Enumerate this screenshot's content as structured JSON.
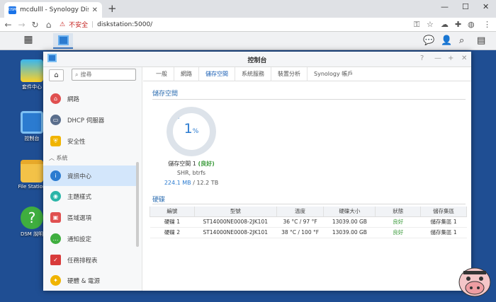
{
  "browser": {
    "tab_title": "mcdulll - Synology DiskStation",
    "favicon_text": "DSM",
    "security_label": "不安全",
    "url": "diskstation:5000/"
  },
  "desktop": {
    "icons": [
      {
        "label": "套件中心",
        "icon": "package-center-icon"
      },
      {
        "label": "控制台",
        "icon": "control-panel-icon"
      },
      {
        "label": "File Station",
        "icon": "folder-icon"
      },
      {
        "label": "DSM 說明",
        "icon": "help-icon"
      }
    ]
  },
  "window": {
    "title": "控制台",
    "search_placeholder": "搜尋",
    "sidebar": {
      "items": [
        {
          "label": "網路",
          "icon": "network-icon",
          "color": "#e05050"
        },
        {
          "label": "DHCP 伺服器",
          "icon": "dhcp-icon",
          "color": "#5a6e8c"
        },
        {
          "label": "安全性",
          "icon": "shield-icon",
          "color": "#f0b400"
        }
      ],
      "section_label": "系統",
      "system_items": [
        {
          "label": "資訊中心",
          "icon": "info-icon",
          "color": "#2b7bd0",
          "selected": true
        },
        {
          "label": "主題樣式",
          "icon": "palette-icon",
          "color": "#2bb5a8"
        },
        {
          "label": "區域選項",
          "icon": "region-icon",
          "color": "#e05050"
        },
        {
          "label": "通知設定",
          "icon": "notification-icon",
          "color": "#3fae3f"
        },
        {
          "label": "任務排程表",
          "icon": "calendar-icon",
          "color": "#d83b3b"
        },
        {
          "label": "硬體 & 電源",
          "icon": "bulb-icon",
          "color": "#f0b400"
        }
      ]
    },
    "tabs": [
      "一般",
      "網路",
      "儲存空間",
      "系統服務",
      "裝置分析",
      "Synology 帳戶"
    ],
    "active_tab": "儲存空間",
    "storage": {
      "section_title": "儲存空間",
      "usage_percent": "1",
      "usage_unit": "%",
      "pool_name": "儲存空間 1",
      "pool_status": "(良好)",
      "pool_type": "SHR, btrfs",
      "used": "224.1 MB",
      "total": "12.2 TB",
      "usage_color": "#2b7bd0"
    },
    "disks": {
      "section_title": "硬碟",
      "columns": [
        "編號",
        "型號",
        "溫度",
        "硬碟大小",
        "狀態",
        "儲存集區"
      ],
      "rows": [
        {
          "id": "硬碟 1",
          "model": "ST14000NE0008-2JK101",
          "temp": "36 °C / 97 °F",
          "size": "13039.00 GB",
          "status": "良好",
          "pool": "儲存集區 1"
        },
        {
          "id": "硬碟 2",
          "model": "ST14000NE0008-2JK101",
          "temp": "38 °C / 100 °F",
          "size": "13039.00 GB",
          "status": "良好",
          "pool": "儲存集區 1"
        }
      ]
    }
  }
}
